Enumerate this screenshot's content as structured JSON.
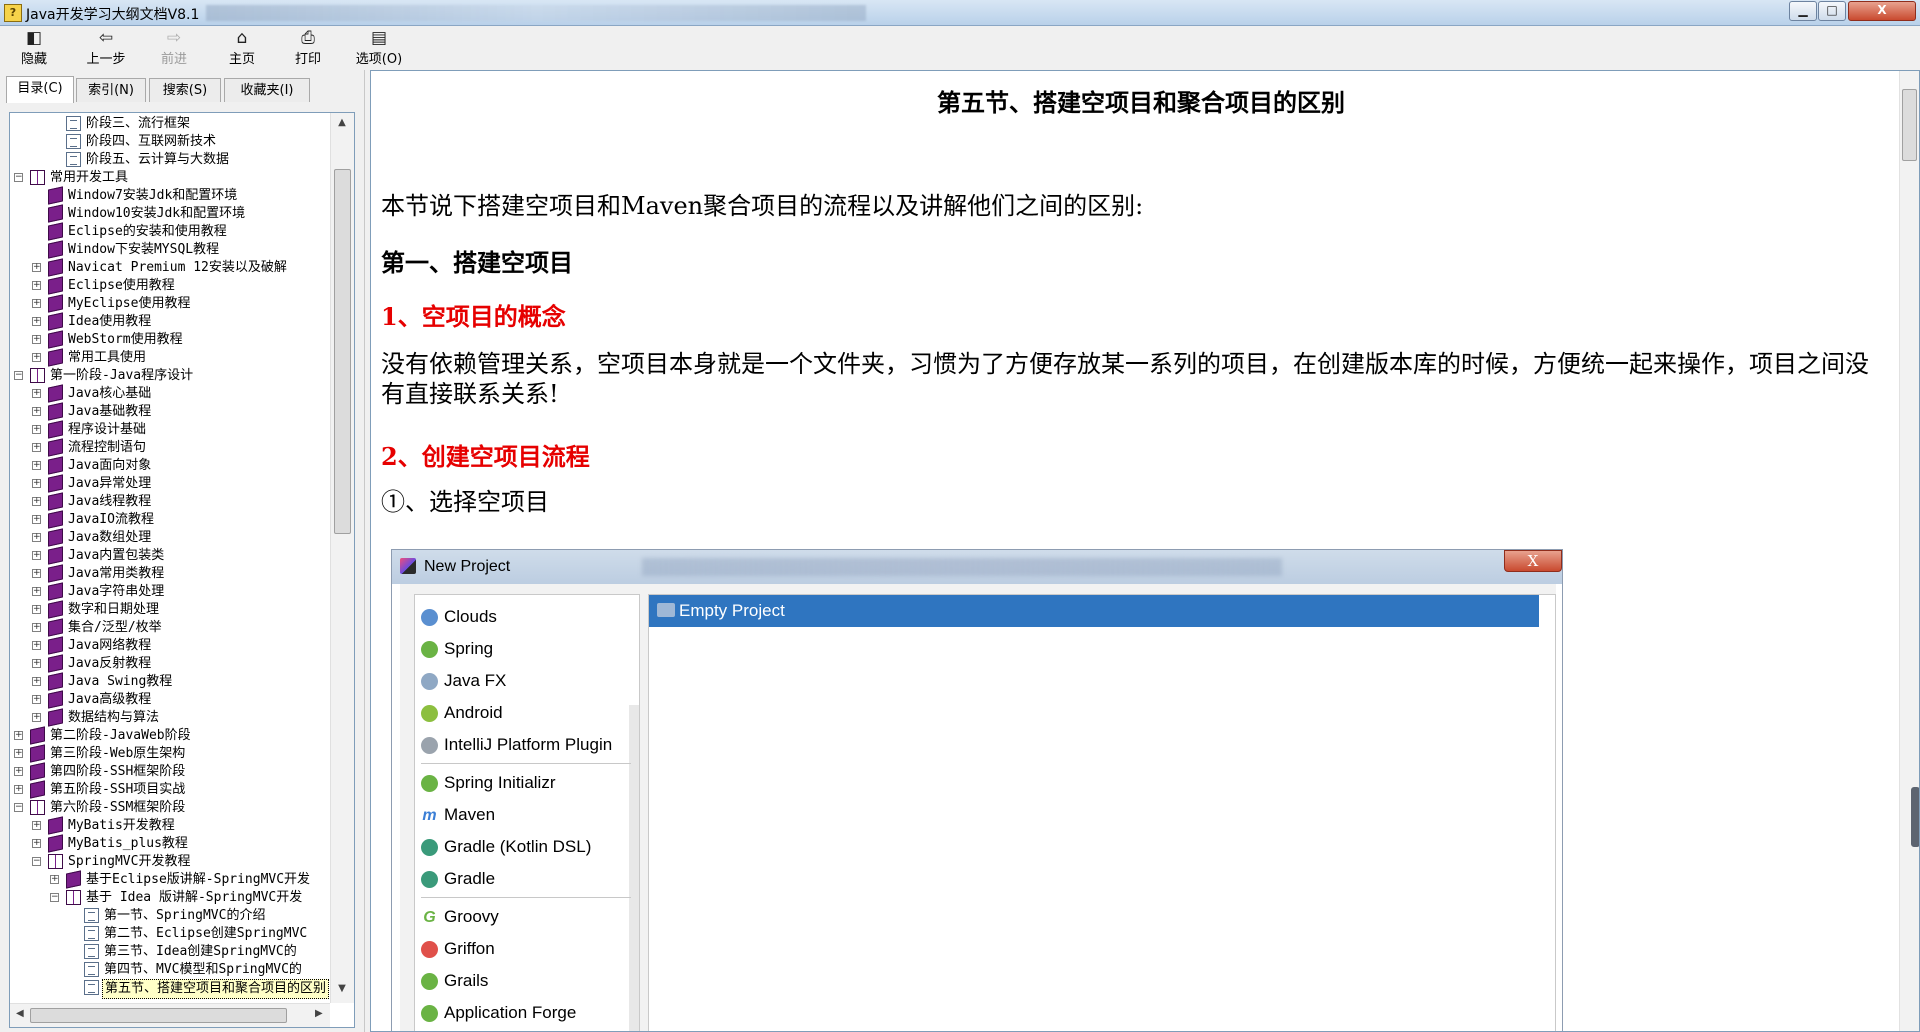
{
  "window": {
    "title": "Java开发学习大纲文档V8.1"
  },
  "window_buttons": {
    "minimize": "▁",
    "maximize": "□",
    "close": "X"
  },
  "toolbar": [
    {
      "label": "隐藏",
      "icon": "hide-icon",
      "glyph": "◧",
      "enabled": true
    },
    {
      "label": "上一步",
      "icon": "back-arrow-icon",
      "glyph": "⇦",
      "enabled": true
    },
    {
      "label": "前进",
      "icon": "forward-arrow-icon",
      "glyph": "⇨",
      "enabled": false
    },
    {
      "label": "主页",
      "icon": "home-icon",
      "glyph": "⌂",
      "enabled": true
    },
    {
      "label": "打印",
      "icon": "print-icon",
      "glyph": "⎙",
      "enabled": true
    },
    {
      "label": "选项(O)",
      "icon": "options-icon",
      "glyph": "▤",
      "enabled": true
    }
  ],
  "nav_tabs": [
    {
      "label": "目录(C)",
      "active": true
    },
    {
      "label": "索引(N)",
      "active": false
    },
    {
      "label": "搜索(S)",
      "active": false
    },
    {
      "label": "收藏夹(I)",
      "active": false
    }
  ],
  "tree": [
    {
      "level": 2,
      "icon": "page",
      "toggle": "",
      "label": "阶段三、流行框架"
    },
    {
      "level": 2,
      "icon": "page",
      "toggle": "",
      "label": "阶段四、互联网新技术"
    },
    {
      "level": 2,
      "icon": "page",
      "toggle": "",
      "label": "阶段五、云计算与大数据"
    },
    {
      "level": 0,
      "icon": "book-open",
      "toggle": "-",
      "label": "常用开发工具"
    },
    {
      "level": 1,
      "icon": "book",
      "toggle": "",
      "label": "Window7安装Jdk和配置环境"
    },
    {
      "level": 1,
      "icon": "book",
      "toggle": "",
      "label": "Window10安装Jdk和配置环境"
    },
    {
      "level": 1,
      "icon": "book",
      "toggle": "",
      "label": "Eclipse的安装和使用教程"
    },
    {
      "level": 1,
      "icon": "book",
      "toggle": "",
      "label": "Window下安装MYSQL教程"
    },
    {
      "level": 1,
      "icon": "book",
      "toggle": "+",
      "label": "Navicat Premium 12安装以及破解"
    },
    {
      "level": 1,
      "icon": "book",
      "toggle": "+",
      "label": "Eclipse使用教程"
    },
    {
      "level": 1,
      "icon": "book",
      "toggle": "+",
      "label": "MyEclipse使用教程"
    },
    {
      "level": 1,
      "icon": "book",
      "toggle": "+",
      "label": "Idea使用教程"
    },
    {
      "level": 1,
      "icon": "book",
      "toggle": "+",
      "label": "WebStorm使用教程"
    },
    {
      "level": 1,
      "icon": "book",
      "toggle": "+",
      "label": "常用工具使用"
    },
    {
      "level": 0,
      "icon": "book-open",
      "toggle": "-",
      "label": "第一阶段-Java程序设计"
    },
    {
      "level": 1,
      "icon": "book",
      "toggle": "+",
      "label": "Java核心基础"
    },
    {
      "level": 1,
      "icon": "book",
      "toggle": "+",
      "label": "Java基础教程"
    },
    {
      "level": 1,
      "icon": "book",
      "toggle": "+",
      "label": "程序设计基础"
    },
    {
      "level": 1,
      "icon": "book",
      "toggle": "+",
      "label": "流程控制语句"
    },
    {
      "level": 1,
      "icon": "book",
      "toggle": "+",
      "label": "Java面向对象"
    },
    {
      "level": 1,
      "icon": "book",
      "toggle": "+",
      "label": "Java异常处理"
    },
    {
      "level": 1,
      "icon": "book",
      "toggle": "+",
      "label": "Java线程教程"
    },
    {
      "level": 1,
      "icon": "book",
      "toggle": "+",
      "label": "JavaIO流教程"
    },
    {
      "level": 1,
      "icon": "book",
      "toggle": "+",
      "label": "Java数组处理"
    },
    {
      "level": 1,
      "icon": "book",
      "toggle": "+",
      "label": "Java内置包装类"
    },
    {
      "level": 1,
      "icon": "book",
      "toggle": "+",
      "label": "Java常用类教程"
    },
    {
      "level": 1,
      "icon": "book",
      "toggle": "+",
      "label": "Java字符串处理"
    },
    {
      "level": 1,
      "icon": "book",
      "toggle": "+",
      "label": "数字和日期处理"
    },
    {
      "level": 1,
      "icon": "book",
      "toggle": "+",
      "label": "集合/泛型/枚举"
    },
    {
      "level": 1,
      "icon": "book",
      "toggle": "+",
      "label": "Java网络教程"
    },
    {
      "level": 1,
      "icon": "book",
      "toggle": "+",
      "label": "Java反射教程"
    },
    {
      "level": 1,
      "icon": "book",
      "toggle": "+",
      "label": "Java Swing教程"
    },
    {
      "level": 1,
      "icon": "book",
      "toggle": "+",
      "label": "Java高级教程"
    },
    {
      "level": 1,
      "icon": "book",
      "toggle": "+",
      "label": "数据结构与算法"
    },
    {
      "level": 0,
      "icon": "book",
      "toggle": "+",
      "label": "第二阶段-JavaWeb阶段"
    },
    {
      "level": 0,
      "icon": "book",
      "toggle": "+",
      "label": "第三阶段-Web原生架构"
    },
    {
      "level": 0,
      "icon": "book",
      "toggle": "+",
      "label": "第四阶段-SSH框架阶段"
    },
    {
      "level": 0,
      "icon": "book",
      "toggle": "+",
      "label": "第五阶段-SSH项目实战"
    },
    {
      "level": 0,
      "icon": "book-open",
      "toggle": "-",
      "label": "第六阶段-SSM框架阶段"
    },
    {
      "level": 1,
      "icon": "book",
      "toggle": "+",
      "label": "MyBatis开发教程"
    },
    {
      "level": 1,
      "icon": "book",
      "toggle": "+",
      "label": "MyBatis_plus教程"
    },
    {
      "level": 1,
      "icon": "book-open",
      "toggle": "-",
      "label": "SpringMVC开发教程"
    },
    {
      "level": 2,
      "icon": "book",
      "toggle": "+",
      "label": "基于Eclipse版讲解-SpringMVC开发"
    },
    {
      "level": 2,
      "icon": "book-open",
      "toggle": "-",
      "label": "基于 Idea 版讲解-SpringMVC开发"
    },
    {
      "level": 3,
      "icon": "page",
      "toggle": "",
      "label": "第一节、SpringMVC的介绍"
    },
    {
      "level": 3,
      "icon": "page",
      "toggle": "",
      "label": "第二节、Eclipse创建SpringMVC"
    },
    {
      "level": 3,
      "icon": "page",
      "toggle": "",
      "label": "第三节、Idea创建SpringMVC的"
    },
    {
      "level": 3,
      "icon": "page",
      "toggle": "",
      "label": "第四节、MVC模型和SpringMVC的"
    },
    {
      "level": 3,
      "icon": "page",
      "toggle": "",
      "label": "第五节、搭建空项目和聚合项目的区别",
      "selected": true
    }
  ],
  "content": {
    "title": "第五节、搭建空项目和聚合项目的区别",
    "intro": "本节说下搭建空项目和Maven聚合项目的流程以及讲解他们之间的区别:",
    "h1": "第一、搭建空项目",
    "h2": "1、空项目的概念",
    "p1": "没有依赖管理关系，空项目本身就是一个文件夹，习惯为了方便存放某一系列的项目，在创建版本库的时候，方便统一起来操作，项目之间没有直接联系关系!",
    "h3": "2、创建空项目流程",
    "step1": "①、选择空项目"
  },
  "screenshot": {
    "dialog_title": "New Project",
    "close_label": "X",
    "items": [
      {
        "label": "Clouds",
        "icon": "clouds-icon",
        "color": "#5a8fd0"
      },
      {
        "label": "Spring",
        "icon": "spring-leaf-icon",
        "color": "#6ab344"
      },
      {
        "label": "Java FX",
        "icon": "folder-icon",
        "color": "#8fa8c4"
      },
      {
        "label": "Android",
        "icon": "android-icon",
        "color": "#8cbf3f"
      },
      {
        "label": "IntelliJ Platform Plugin",
        "icon": "plugin-icon",
        "color": "#9aa3ad",
        "sep_after": true
      },
      {
        "label": "Spring Initializr",
        "icon": "spring-initializr-icon",
        "color": "#6ab344"
      },
      {
        "label": "Maven",
        "icon": "maven-icon",
        "color": "#3b7fd6",
        "glyph": "m"
      },
      {
        "label": "Gradle (Kotlin DSL)",
        "icon": "gradle-kotlin-icon",
        "color": "#3a9a7a"
      },
      {
        "label": "Gradle",
        "icon": "gradle-icon",
        "color": "#3a9a7a",
        "sep_after": true
      },
      {
        "label": "Groovy",
        "icon": "groovy-icon",
        "color": "#6ab344",
        "glyph": "G"
      },
      {
        "label": "Griffon",
        "icon": "griffon-icon",
        "color": "#e0504a"
      },
      {
        "label": "Grails",
        "icon": "grails-icon",
        "color": "#6ab344"
      },
      {
        "label": "Application Forge",
        "icon": "application-forge-icon",
        "color": "#6ab344"
      }
    ],
    "selected": "Empty Project"
  }
}
